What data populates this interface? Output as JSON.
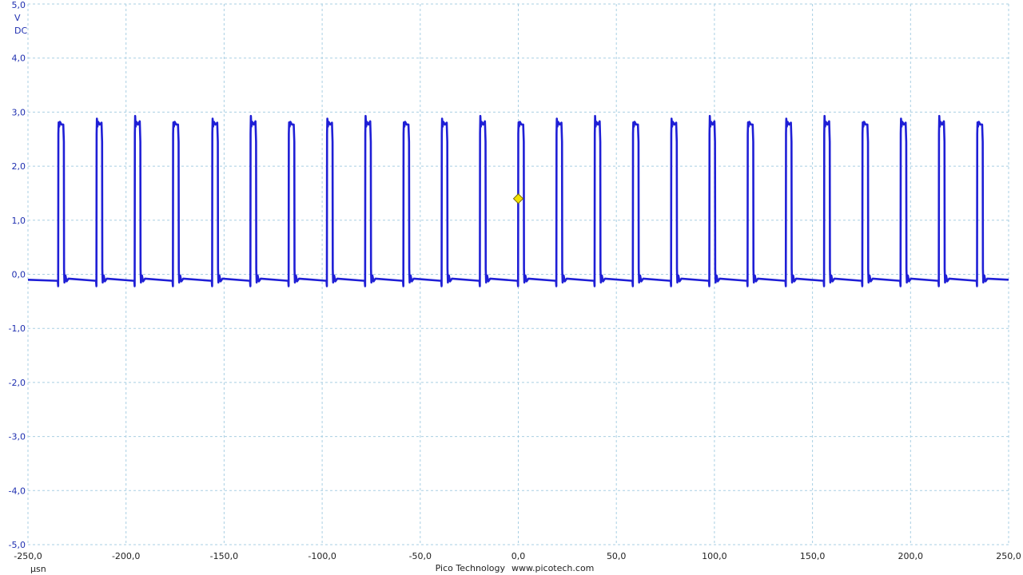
{
  "chart_data": {
    "type": "line",
    "x_unit": "µsn",
    "y_unit": "V",
    "coupling": "DC",
    "xlim": [
      -250,
      250
    ],
    "ylim": [
      -5,
      5
    ],
    "x_ticks": [
      "-250,0",
      "-200,0",
      "-150,0",
      "-100,0",
      "-50,0",
      "0,0",
      "50,0",
      "100,0",
      "150,0",
      "200,0",
      "250,0"
    ],
    "y_ticks": [
      "5,0",
      "4,0",
      "3,0",
      "2,0",
      "1,0",
      "0,0",
      "-1,0",
      "-2,0",
      "-3,0",
      "-4,0",
      "-5,0"
    ],
    "grid": true,
    "series": [
      {
        "color": "#1f1fd6",
        "low_level": -0.1,
        "high_level": 2.8,
        "pulse_rising_edges": [
          -234.5,
          -215,
          -195.5,
          -176,
          -156,
          -136.5,
          -117,
          -97.5,
          -78,
          -58.5,
          -39,
          -19.5,
          0,
          19.5,
          39,
          58.5,
          78,
          97.5,
          117,
          136.5,
          156,
          175.5,
          195,
          214.5,
          234
        ],
        "pulse_width": 2.8
      }
    ],
    "trigger_marker": {
      "x": 0,
      "y": 1.4,
      "color": "#f2e200"
    }
  },
  "footer": {
    "brand": "Pico Technology",
    "url": "www.picotech.com"
  }
}
